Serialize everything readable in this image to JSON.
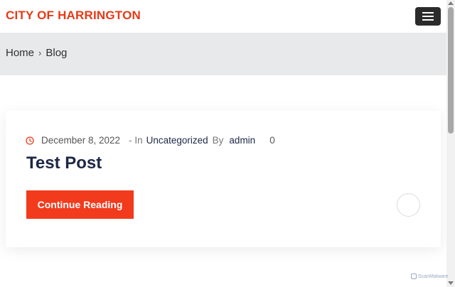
{
  "header": {
    "site_title": "CITY OF HARRINGTON",
    "title_color": "#e63a17",
    "menu_icon": "hamburger-icon"
  },
  "breadcrumb": {
    "home": "Home",
    "separator": "›",
    "current": "Blog"
  },
  "post": {
    "date_icon": "clock-icon",
    "date": "December 8, 2022",
    "in_label": "- In",
    "category": "Uncategorized",
    "by_label": "By",
    "author": "admin",
    "comment_count": "0",
    "title": "Test Post",
    "read_more": "Continue Reading",
    "accent_color": "#f23a1d"
  },
  "watermark": {
    "text": "ScanMalware"
  }
}
